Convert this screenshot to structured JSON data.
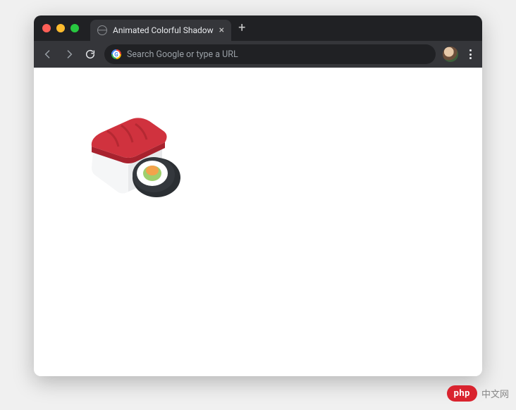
{
  "tab": {
    "title": "Animated Colorful Shadow",
    "close_glyph": "×"
  },
  "new_tab_glyph": "+",
  "omnibox": {
    "placeholder": "Search Google or type a URL"
  },
  "content": {
    "image_name": "sushi-illustration"
  },
  "watermark": {
    "badge": "php",
    "text": "中文网"
  }
}
